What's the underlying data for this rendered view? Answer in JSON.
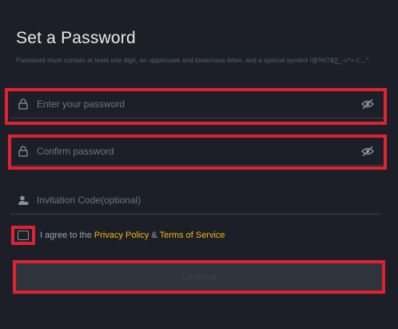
{
  "page": {
    "title": "Set a Password",
    "hint": "Password must contain at least one digit, an uppercase and lowercase letter, and a special symbol !@!%?&[]_-=*+-/:;,.^"
  },
  "fields": {
    "password_placeholder": "Enter your password",
    "confirm_placeholder": "Confirm password",
    "invite_placeholder": "Invitation Code(optional)"
  },
  "agree": {
    "prefix": "I agree to the ",
    "privacy": "Privacy Policy",
    "amp": " & ",
    "terms": "Terms of Service"
  },
  "submit": {
    "label": "Continue"
  },
  "colors": {
    "accent": "#f0b90b",
    "highlight": "#e02230",
    "background": "#1c1f27"
  }
}
